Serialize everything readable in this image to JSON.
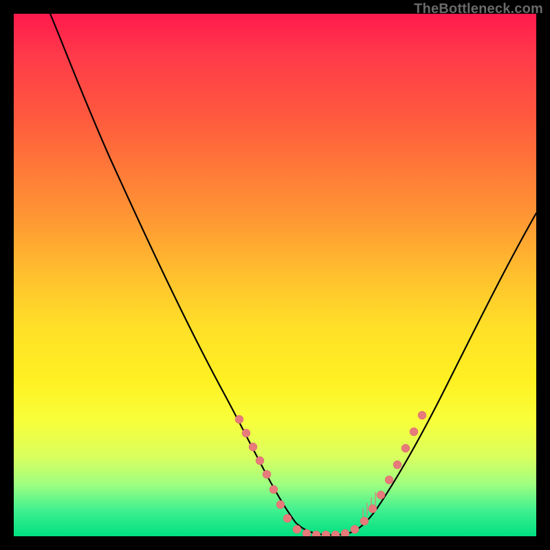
{
  "watermark": "TheBottleneck.com",
  "chart_data": {
    "type": "line",
    "title": "",
    "xlabel": "",
    "ylabel": "",
    "xlim": [
      0,
      100
    ],
    "ylim": [
      0,
      100
    ],
    "grid": false,
    "legend": false,
    "curve": [
      {
        "x": 7,
        "y": 100
      },
      {
        "x": 10,
        "y": 93
      },
      {
        "x": 15,
        "y": 82
      },
      {
        "x": 20,
        "y": 71
      },
      {
        "x": 25,
        "y": 60
      },
      {
        "x": 30,
        "y": 49
      },
      {
        "x": 35,
        "y": 38
      },
      {
        "x": 40,
        "y": 27
      },
      {
        "x": 44,
        "y": 18
      },
      {
        "x": 48,
        "y": 9
      },
      {
        "x": 52,
        "y": 3
      },
      {
        "x": 56,
        "y": 0.5
      },
      {
        "x": 60,
        "y": 0
      },
      {
        "x": 64,
        "y": 0.5
      },
      {
        "x": 68,
        "y": 3
      },
      {
        "x": 72,
        "y": 8
      },
      {
        "x": 76,
        "y": 15
      },
      {
        "x": 80,
        "y": 23
      },
      {
        "x": 85,
        "y": 34
      },
      {
        "x": 90,
        "y": 46
      },
      {
        "x": 95,
        "y": 57
      },
      {
        "x": 100,
        "y": 65
      }
    ],
    "marker_clusters": [
      {
        "side": "left",
        "x_range": [
          43,
          53
        ],
        "count": 8
      },
      {
        "side": "floor",
        "x_range": [
          53,
          67
        ],
        "count": 7
      },
      {
        "side": "right",
        "x_range": [
          67,
          76
        ],
        "count": 8
      }
    ],
    "colors": {
      "background_top": "#ff1a4d",
      "background_bottom": "#00e080",
      "curve": "#000000",
      "markers": "#e77a7a",
      "frame": "#000000"
    }
  }
}
